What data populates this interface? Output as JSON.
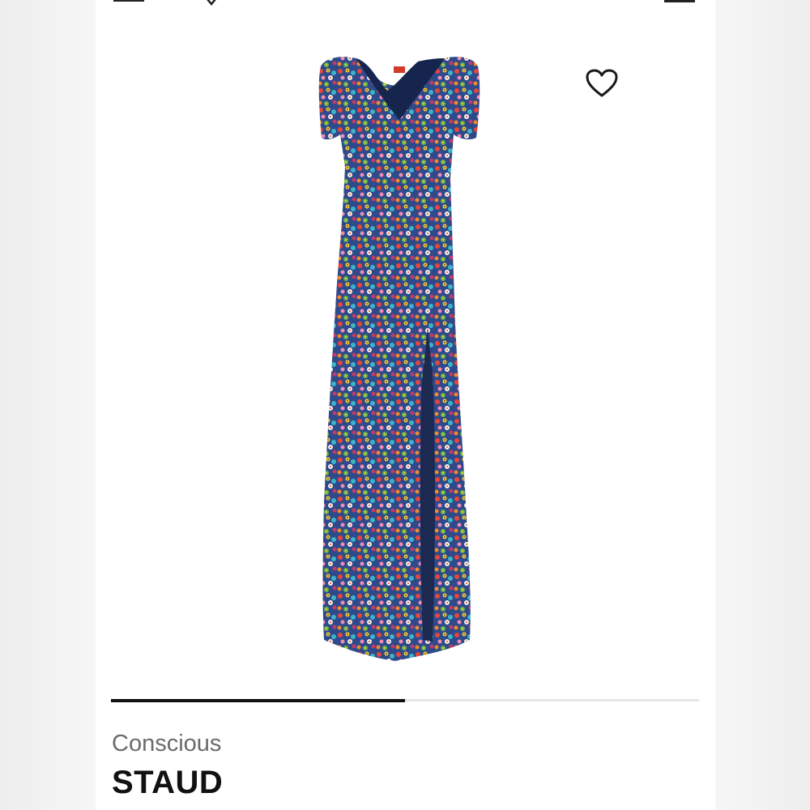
{
  "product": {
    "subtitle": "Conscious",
    "brand": "STAUD",
    "image_name": "floral-maxi-dress"
  },
  "gallery": {
    "progress_fraction": 0.5
  },
  "icons": {
    "menu": "menu-icon",
    "back": "chevron-icon",
    "bag": "bag-icon",
    "wishlist": "heart-icon"
  },
  "colors": {
    "accent": "#111111",
    "subtitle_text": "#6b6b6b",
    "track": "#e6e6e6"
  }
}
